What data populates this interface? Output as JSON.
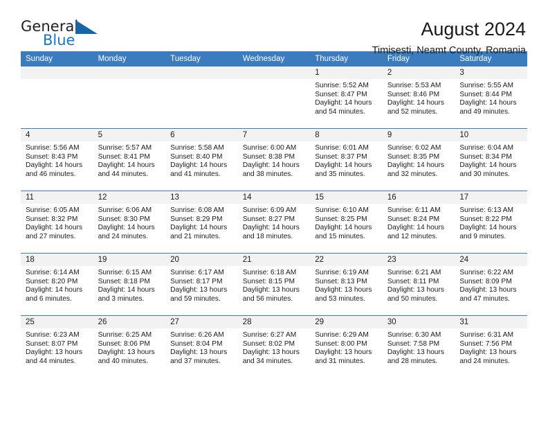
{
  "brand": {
    "name_part1": "General",
    "name_part2": "Blue",
    "logo_icon": "blue-triangle-logo",
    "color_primary": "#1976c4",
    "color_dark": "#231f20"
  },
  "header": {
    "title": "August 2024",
    "subtitle": "Timisesti, Neamt County, Romania"
  },
  "calendar": {
    "accent_color": "#3b7cbf",
    "daynum_bg": "#f2f2f2",
    "weekday_headers": [
      "Sunday",
      "Monday",
      "Tuesday",
      "Wednesday",
      "Thursday",
      "Friday",
      "Saturday"
    ],
    "weeks": [
      [
        {
          "day": "",
          "blank": true
        },
        {
          "day": "",
          "blank": true
        },
        {
          "day": "",
          "blank": true
        },
        {
          "day": "",
          "blank": true
        },
        {
          "day": "1",
          "sunrise": "Sunrise: 5:52 AM",
          "sunset": "Sunset: 8:47 PM",
          "daylight1": "Daylight: 14 hours",
          "daylight2": "and 54 minutes."
        },
        {
          "day": "2",
          "sunrise": "Sunrise: 5:53 AM",
          "sunset": "Sunset: 8:46 PM",
          "daylight1": "Daylight: 14 hours",
          "daylight2": "and 52 minutes."
        },
        {
          "day": "3",
          "sunrise": "Sunrise: 5:55 AM",
          "sunset": "Sunset: 8:44 PM",
          "daylight1": "Daylight: 14 hours",
          "daylight2": "and 49 minutes."
        }
      ],
      [
        {
          "day": "4",
          "sunrise": "Sunrise: 5:56 AM",
          "sunset": "Sunset: 8:43 PM",
          "daylight1": "Daylight: 14 hours",
          "daylight2": "and 46 minutes."
        },
        {
          "day": "5",
          "sunrise": "Sunrise: 5:57 AM",
          "sunset": "Sunset: 8:41 PM",
          "daylight1": "Daylight: 14 hours",
          "daylight2": "and 44 minutes."
        },
        {
          "day": "6",
          "sunrise": "Sunrise: 5:58 AM",
          "sunset": "Sunset: 8:40 PM",
          "daylight1": "Daylight: 14 hours",
          "daylight2": "and 41 minutes."
        },
        {
          "day": "7",
          "sunrise": "Sunrise: 6:00 AM",
          "sunset": "Sunset: 8:38 PM",
          "daylight1": "Daylight: 14 hours",
          "daylight2": "and 38 minutes."
        },
        {
          "day": "8",
          "sunrise": "Sunrise: 6:01 AM",
          "sunset": "Sunset: 8:37 PM",
          "daylight1": "Daylight: 14 hours",
          "daylight2": "and 35 minutes."
        },
        {
          "day": "9",
          "sunrise": "Sunrise: 6:02 AM",
          "sunset": "Sunset: 8:35 PM",
          "daylight1": "Daylight: 14 hours",
          "daylight2": "and 32 minutes."
        },
        {
          "day": "10",
          "sunrise": "Sunrise: 6:04 AM",
          "sunset": "Sunset: 8:34 PM",
          "daylight1": "Daylight: 14 hours",
          "daylight2": "and 30 minutes."
        }
      ],
      [
        {
          "day": "11",
          "sunrise": "Sunrise: 6:05 AM",
          "sunset": "Sunset: 8:32 PM",
          "daylight1": "Daylight: 14 hours",
          "daylight2": "and 27 minutes."
        },
        {
          "day": "12",
          "sunrise": "Sunrise: 6:06 AM",
          "sunset": "Sunset: 8:30 PM",
          "daylight1": "Daylight: 14 hours",
          "daylight2": "and 24 minutes."
        },
        {
          "day": "13",
          "sunrise": "Sunrise: 6:08 AM",
          "sunset": "Sunset: 8:29 PM",
          "daylight1": "Daylight: 14 hours",
          "daylight2": "and 21 minutes."
        },
        {
          "day": "14",
          "sunrise": "Sunrise: 6:09 AM",
          "sunset": "Sunset: 8:27 PM",
          "daylight1": "Daylight: 14 hours",
          "daylight2": "and 18 minutes."
        },
        {
          "day": "15",
          "sunrise": "Sunrise: 6:10 AM",
          "sunset": "Sunset: 8:25 PM",
          "daylight1": "Daylight: 14 hours",
          "daylight2": "and 15 minutes."
        },
        {
          "day": "16",
          "sunrise": "Sunrise: 6:11 AM",
          "sunset": "Sunset: 8:24 PM",
          "daylight1": "Daylight: 14 hours",
          "daylight2": "and 12 minutes."
        },
        {
          "day": "17",
          "sunrise": "Sunrise: 6:13 AM",
          "sunset": "Sunset: 8:22 PM",
          "daylight1": "Daylight: 14 hours",
          "daylight2": "and 9 minutes."
        }
      ],
      [
        {
          "day": "18",
          "sunrise": "Sunrise: 6:14 AM",
          "sunset": "Sunset: 8:20 PM",
          "daylight1": "Daylight: 14 hours",
          "daylight2": "and 6 minutes."
        },
        {
          "day": "19",
          "sunrise": "Sunrise: 6:15 AM",
          "sunset": "Sunset: 8:18 PM",
          "daylight1": "Daylight: 14 hours",
          "daylight2": "and 3 minutes."
        },
        {
          "day": "20",
          "sunrise": "Sunrise: 6:17 AM",
          "sunset": "Sunset: 8:17 PM",
          "daylight1": "Daylight: 13 hours",
          "daylight2": "and 59 minutes."
        },
        {
          "day": "21",
          "sunrise": "Sunrise: 6:18 AM",
          "sunset": "Sunset: 8:15 PM",
          "daylight1": "Daylight: 13 hours",
          "daylight2": "and 56 minutes."
        },
        {
          "day": "22",
          "sunrise": "Sunrise: 6:19 AM",
          "sunset": "Sunset: 8:13 PM",
          "daylight1": "Daylight: 13 hours",
          "daylight2": "and 53 minutes."
        },
        {
          "day": "23",
          "sunrise": "Sunrise: 6:21 AM",
          "sunset": "Sunset: 8:11 PM",
          "daylight1": "Daylight: 13 hours",
          "daylight2": "and 50 minutes."
        },
        {
          "day": "24",
          "sunrise": "Sunrise: 6:22 AM",
          "sunset": "Sunset: 8:09 PM",
          "daylight1": "Daylight: 13 hours",
          "daylight2": "and 47 minutes."
        }
      ],
      [
        {
          "day": "25",
          "sunrise": "Sunrise: 6:23 AM",
          "sunset": "Sunset: 8:07 PM",
          "daylight1": "Daylight: 13 hours",
          "daylight2": "and 44 minutes."
        },
        {
          "day": "26",
          "sunrise": "Sunrise: 6:25 AM",
          "sunset": "Sunset: 8:06 PM",
          "daylight1": "Daylight: 13 hours",
          "daylight2": "and 40 minutes."
        },
        {
          "day": "27",
          "sunrise": "Sunrise: 6:26 AM",
          "sunset": "Sunset: 8:04 PM",
          "daylight1": "Daylight: 13 hours",
          "daylight2": "and 37 minutes."
        },
        {
          "day": "28",
          "sunrise": "Sunrise: 6:27 AM",
          "sunset": "Sunset: 8:02 PM",
          "daylight1": "Daylight: 13 hours",
          "daylight2": "and 34 minutes."
        },
        {
          "day": "29",
          "sunrise": "Sunrise: 6:29 AM",
          "sunset": "Sunset: 8:00 PM",
          "daylight1": "Daylight: 13 hours",
          "daylight2": "and 31 minutes."
        },
        {
          "day": "30",
          "sunrise": "Sunrise: 6:30 AM",
          "sunset": "Sunset: 7:58 PM",
          "daylight1": "Daylight: 13 hours",
          "daylight2": "and 28 minutes."
        },
        {
          "day": "31",
          "sunrise": "Sunrise: 6:31 AM",
          "sunset": "Sunset: 7:56 PM",
          "daylight1": "Daylight: 13 hours",
          "daylight2": "and 24 minutes."
        }
      ]
    ]
  }
}
